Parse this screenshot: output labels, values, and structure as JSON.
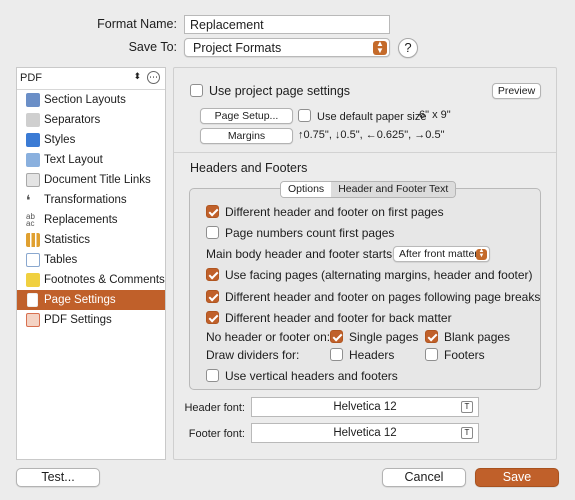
{
  "top": {
    "format_name_label": "Format Name:",
    "format_name_value": "Replacement",
    "save_to_label": "Save To:",
    "save_to_value": "Project Formats",
    "help_label": "?"
  },
  "sidebar": {
    "header": "PDF",
    "items": [
      {
        "label": "Section Layouts",
        "icon": "brush-icon",
        "color": "#6b8fc7"
      },
      {
        "label": "Separators",
        "icon": "separators-icon",
        "color": "#9a9a9a"
      },
      {
        "label": "Styles",
        "icon": "styles-icon",
        "color": "#3b7bd4"
      },
      {
        "label": "Text Layout",
        "icon": "text-layout-icon",
        "color": "#8ab0de"
      },
      {
        "label": "Document Title Links",
        "icon": "document-icon",
        "color": "#a9a9a9"
      },
      {
        "label": "Transformations",
        "icon": "quote-icon",
        "color": "#555555"
      },
      {
        "label": "Replacements",
        "icon": "replace-icon",
        "color": "#7a7a7a"
      },
      {
        "label": "Statistics",
        "icon": "chart-icon",
        "color": "#e0a030"
      },
      {
        "label": "Tables",
        "icon": "table-icon",
        "color": "#8aa8cf"
      },
      {
        "label": "Footnotes & Comments",
        "icon": "note-icon",
        "color": "#f0d040"
      },
      {
        "label": "Page Settings",
        "icon": "page-icon",
        "color": "#ffffff",
        "selected": true
      },
      {
        "label": "PDF Settings",
        "icon": "pdf-icon",
        "color": "#d87050"
      }
    ]
  },
  "page": {
    "use_project_settings": "Use project page settings",
    "preview_button": "Preview",
    "page_setup_button": "Page Setup...",
    "use_default_paper": "Use default paper size",
    "paper_size": "6\" x 9\"",
    "margins_button": "Margins",
    "margins_value": "↑0.75\", ↓0.5\", ←0.625\", →0.5\"",
    "section_title": "Headers and Footers",
    "tabs": [
      "Options",
      "Header and Footer Text"
    ],
    "opt_diff_first": "Different header and footer on first pages",
    "opt_page_numbers": "Page numbers count first pages",
    "main_body_label": "Main body header and footer starts:",
    "main_body_value": "After front matter",
    "opt_facing": "Use facing pages (alternating margins, header and footer)",
    "opt_breaks": "Different header and footer on pages following page breaks",
    "opt_back_matter": "Different header and footer for back matter",
    "no_header_label": "No header or footer on:",
    "single_pages": "Single pages",
    "blank_pages": "Blank pages",
    "dividers_label": "Draw dividers for:",
    "headers": "Headers",
    "footers": "Footers",
    "opt_vertical": "Use vertical headers and footers",
    "header_font_label": "Header font:",
    "header_font_value": "Helvetica 12",
    "footer_font_label": "Footer font:",
    "footer_font_value": "Helvetica 12",
    "font_glyph": "T"
  },
  "bottom": {
    "test_button": "Test...",
    "cancel_button": "Cancel",
    "save_button": "Save"
  },
  "colors": {
    "accent": "#c0602a"
  }
}
